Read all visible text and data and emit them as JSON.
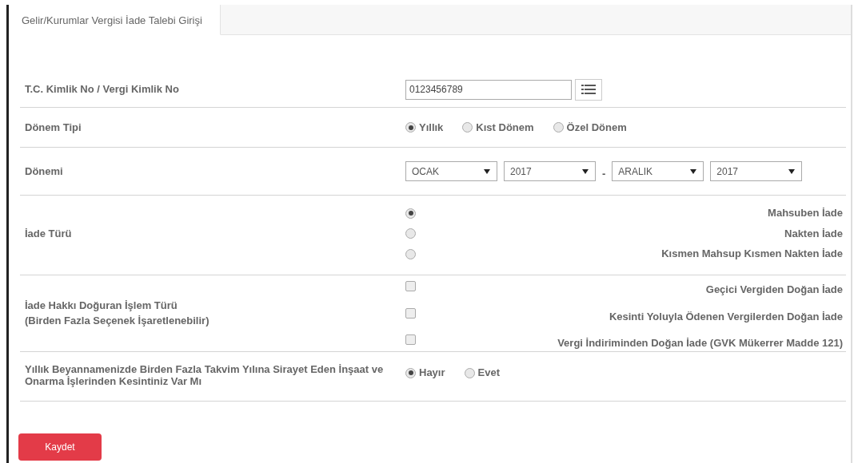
{
  "tabs": [
    {
      "label": "Gelir/Kurumlar Vergisi İade Talebi Girişi",
      "selected": true
    }
  ],
  "rows": [
    {
      "kind": "text_input",
      "label": [
        "T.C. Kimlik No / Vergi Kimlik No"
      ],
      "value": "0123456789"
    },
    {
      "kind": "radio_inline",
      "label": [
        "Dönem Tipi"
      ],
      "options": [
        {
          "label": "Yıllık",
          "selected": true
        },
        {
          "label": "Kıst Dönem",
          "selected": false
        },
        {
          "label": "Özel Dönem",
          "selected": false
        }
      ]
    },
    {
      "kind": "period",
      "label": [
        "Dönemi"
      ],
      "start": [
        "OCAK",
        "2017"
      ],
      "separator": "-",
      "end": [
        "ARALIK",
        "2017"
      ]
    },
    {
      "kind": "radio_list",
      "label": [
        "İade Türü"
      ],
      "options": [
        {
          "label": "Mahsuben İade",
          "selected": true
        },
        {
          "label": "Nakten İade",
          "selected": false
        },
        {
          "label": "Kısmen Mahsup Kısmen Nakten İade",
          "selected": false
        }
      ]
    },
    {
      "kind": "checkbox_list",
      "label": [
        "İade Hakkı Doğuran İşlem Türü",
        "(Birden Fazla Seçenek İşaretlenebilir)"
      ],
      "options": [
        {
          "label": "Geçici Vergiden Doğan İade",
          "checked": false
        },
        {
          "label": "Kesinti Yoluyla Ödenen Vergilerden Doğan İade",
          "checked": false
        },
        {
          "label": "Vergi İndiriminden Doğan İade (GVK Mükerrer Madde 121)",
          "checked": false
        }
      ]
    },
    {
      "kind": "radio_inline",
      "label": [
        "Yıllık Beyannamenizde Birden Fazla Takvim Yılına Sirayet Eden İnşaat ve Onarma İşlerinden Kesintiniz Var Mı"
      ],
      "options": [
        {
          "label": "Hayır",
          "selected": true
        },
        {
          "label": "Evet",
          "selected": false
        }
      ]
    }
  ],
  "save_button": "Kaydet"
}
